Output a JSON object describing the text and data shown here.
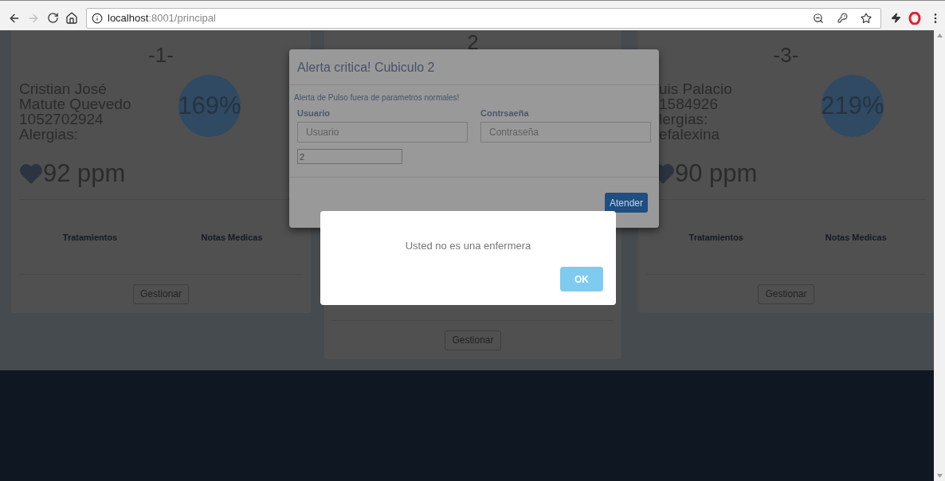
{
  "browser": {
    "url_host": "localhost",
    "url_rest": ":8001/principal"
  },
  "cards": [
    {
      "number": "-1-",
      "info_lines": [
        "Cristian José",
        "Matute Quevedo",
        "1052702924",
        "Alergias:"
      ],
      "percent": "169%",
      "pulse": "92 ppm",
      "sections": [
        "Tratamientos",
        "Notas Medicas"
      ],
      "button": "Gestionar"
    },
    {
      "number": "2",
      "button": "Gestionar"
    },
    {
      "number": "-3-",
      "info_lines": [
        "uis Palacio",
        "1584926",
        "lergias:",
        "efalexina"
      ],
      "percent": "219%",
      "pulse": "90 ppm",
      "sections": [
        "Tratamientos",
        "Notas Medicas"
      ],
      "button": "Gestionar"
    }
  ],
  "alert_modal": {
    "title": "Alerta critica! Cubiculo 2",
    "message": "Alerta de Pulso fuera de parametros normales!",
    "fields": [
      {
        "label": "Usuario",
        "placeholder": "Usuario"
      },
      {
        "label": "Contrsaeña",
        "placeholder": "Contraseña"
      }
    ],
    "cubicle_value": "2",
    "button": "Atender"
  },
  "message_dialog": {
    "text": "Usted no es una enfermera",
    "button": "OK"
  }
}
